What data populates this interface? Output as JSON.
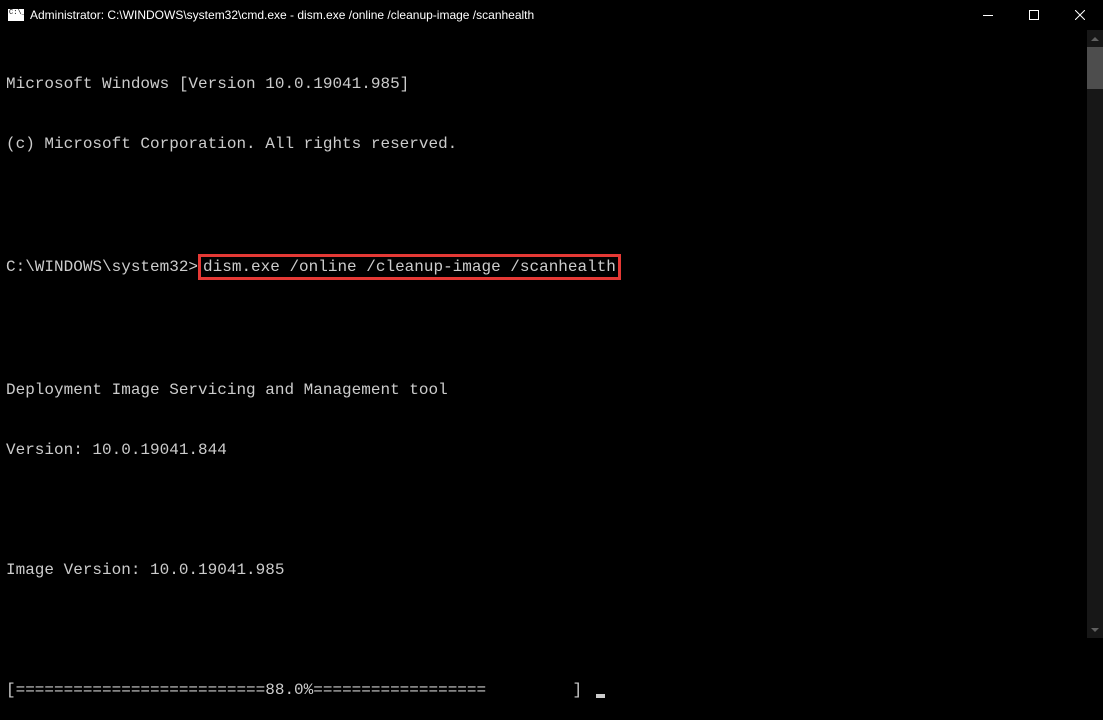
{
  "window": {
    "title": "Administrator: C:\\WINDOWS\\system32\\cmd.exe - dism.exe  /online /cleanup-image /scanhealth"
  },
  "terminal": {
    "line1": "Microsoft Windows [Version 10.0.19041.985]",
    "line2": "(c) Microsoft Corporation. All rights reserved.",
    "prompt_prefix": "C:\\WINDOWS\\system32>",
    "command": "dism.exe /online /cleanup-image /scanhealth",
    "tool_name": "Deployment Image Servicing and Management tool",
    "version_line": "Version: 10.0.19041.844",
    "image_version": "Image Version: 10.0.19041.985",
    "progress_open": "[==========================",
    "progress_pct": "88.0%",
    "progress_rest": "==================         ] "
  }
}
